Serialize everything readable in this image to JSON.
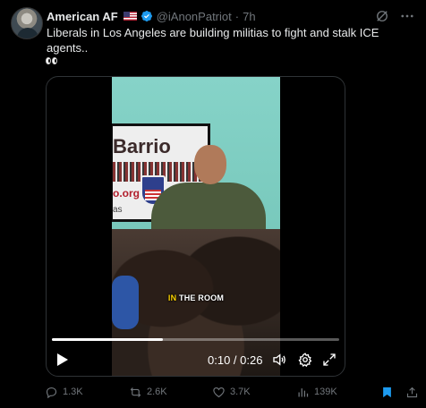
{
  "author": {
    "name": "American AF",
    "handle": "@iAnonPatriot",
    "separator": "·",
    "time": "7h"
  },
  "tweet": {
    "text": "Liberals in Los Angeles are building militias to fight and stalk ICE agents..",
    "emoji_icon": "eyes-emoji"
  },
  "video": {
    "banner_text": "Barrio",
    "banner_url_fragment": "o.org",
    "banner_side_text": "as",
    "caption_highlight": "IN",
    "caption_rest": " THE ROOM",
    "current_time": "0:10",
    "time_separator": " / ",
    "duration": "0:26",
    "progress": 0.385
  },
  "actions": {
    "replies": "1.3K",
    "reposts": "2.6K",
    "likes": "3.7K",
    "views": "139K"
  },
  "colors": {
    "background": "#000000",
    "text": "#e7e9ea",
    "muted": "#71767b",
    "accent": "#1d9bf0",
    "verified": "#1d9bf0"
  }
}
